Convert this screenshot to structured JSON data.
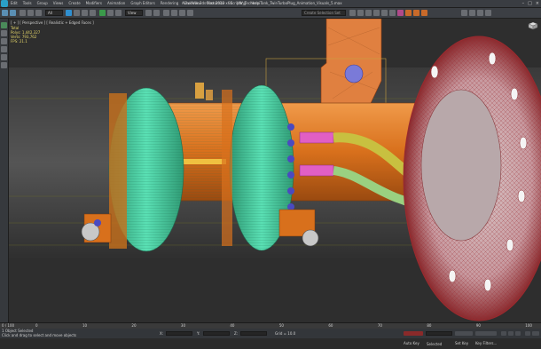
{
  "titlebar": {
    "menus": [
      "Edit",
      "Tools",
      "Group",
      "Views",
      "Create",
      "Modifiers",
      "Animation",
      "Graph Editors",
      "Rendering",
      "Civil View",
      "Customize",
      "Scripting",
      "Help"
    ],
    "title": "Autodesk 3ds Max 2012 x64",
    "file": "VW_TechnoniTank_TwinTurboPlug_Animation_Visuals_5.max",
    "search_placeholder": "Type a keyword or phrase"
  },
  "toolbar": {
    "selection_filter": "All",
    "view_mode": "View",
    "named_selection_placeholder": "Create Selection Set"
  },
  "viewport": {
    "label": "[ + ] [ Perspective ] [ Realistic + Edged Faces ]",
    "stats_header": "Total",
    "stats": [
      {
        "label": "Polys:",
        "value": "1,442,327"
      },
      {
        "label": "Verts:",
        "value": "793,762"
      },
      {
        "label": "FPS:",
        "value": "21.1"
      }
    ]
  },
  "timeline": {
    "frame_display": "0 / 100",
    "ticks": [
      "0",
      "10",
      "20",
      "30",
      "40",
      "50",
      "60",
      "70",
      "80",
      "90",
      "100"
    ]
  },
  "status": {
    "selection": "1 Object Selected",
    "prompt": "Click and drag to select and move objects",
    "x_label": "X:",
    "y_label": "Y:",
    "z_label": "Z:",
    "grid": "Grid = 10.0",
    "autokey": "Auto Key",
    "selected_dropdown": "Selected",
    "setkey": "Set Key",
    "key_filters": "Key Filters..."
  },
  "colors": {
    "orange": "#d8701c",
    "green_coil": "#42c89c",
    "flange_red": "#b0282a",
    "pink": "#e15fc4",
    "yellow_tube": "#c8c040"
  }
}
